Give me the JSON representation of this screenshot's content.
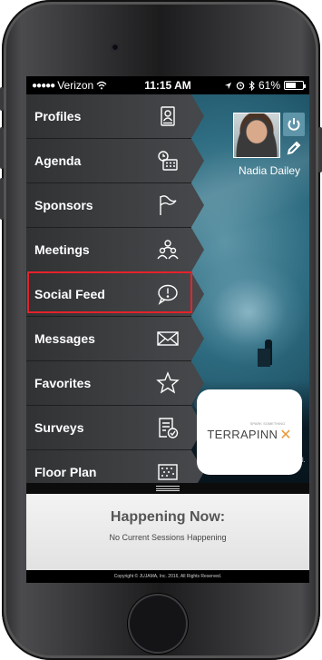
{
  "status_bar": {
    "carrier": "Verizon",
    "time": "11:15 AM",
    "battery": "61%",
    "battery_level": 0.61,
    "signal_dots": "●●●●●"
  },
  "menu": {
    "items": [
      {
        "label": "Profiles",
        "icon": "profile-card-icon"
      },
      {
        "label": "Agenda",
        "icon": "calendar-clock-icon"
      },
      {
        "label": "Sponsors",
        "icon": "flag-icon"
      },
      {
        "label": "Meetings",
        "icon": "people-meeting-icon"
      },
      {
        "label": "Social Feed",
        "icon": "speech-bubble-exclamation-icon"
      },
      {
        "label": "Messages",
        "icon": "envelope-icon"
      },
      {
        "label": "Favorites",
        "icon": "star-icon"
      },
      {
        "label": "Surveys",
        "icon": "survey-check-icon"
      },
      {
        "label": "Floor Plan",
        "icon": "floor-plan-icon"
      }
    ],
    "highlighted_index": 4
  },
  "profile": {
    "name": "Nadia Dailey"
  },
  "sponsor": {
    "name": "TERRAPINN",
    "tagline": "SPARK SOMETHING"
  },
  "happening": {
    "title": "Happening Now:",
    "subtitle": "No Current Sessions Happening"
  },
  "footer": {
    "copyright": "Copyright © JUJAMA, Inc. 2016, All Rights Reserved."
  },
  "colors": {
    "highlight": "#e5222b",
    "menu_bg": "#3d3f41",
    "accent": "#5f95a8"
  }
}
